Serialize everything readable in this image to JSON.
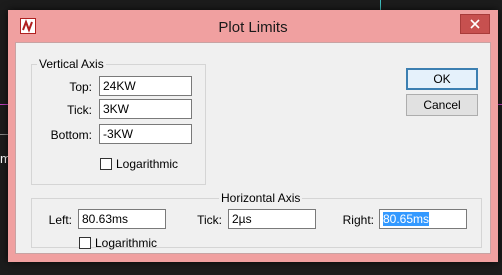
{
  "background": {
    "left_label": "m"
  },
  "dialog": {
    "title": "Plot Limits",
    "icon": "ltspice-icon",
    "close_icon": "close-icon"
  },
  "vertical_axis": {
    "legend": "Vertical Axis",
    "top_label": "Top:",
    "top_value": "24KW",
    "tick_label": "Tick:",
    "tick_value": "3KW",
    "bottom_label": "Bottom:",
    "bottom_value": "-3KW",
    "log_label": "Logarithmic",
    "log_checked": false
  },
  "horizontal_axis": {
    "legend": "Horizontal Axis",
    "left_label": "Left:",
    "left_value": "80.63ms",
    "tick_label": "Tick:",
    "tick_value": "2µs",
    "right_label": "Right:",
    "right_value": "80.65ms",
    "log_label": "Logarithmic",
    "log_checked": false
  },
  "buttons": {
    "ok": "OK",
    "cancel": "Cancel"
  },
  "colors": {
    "dialog_frame": "#f0a0a0",
    "close_button": "#c7504f",
    "selection": "#3399ff"
  }
}
